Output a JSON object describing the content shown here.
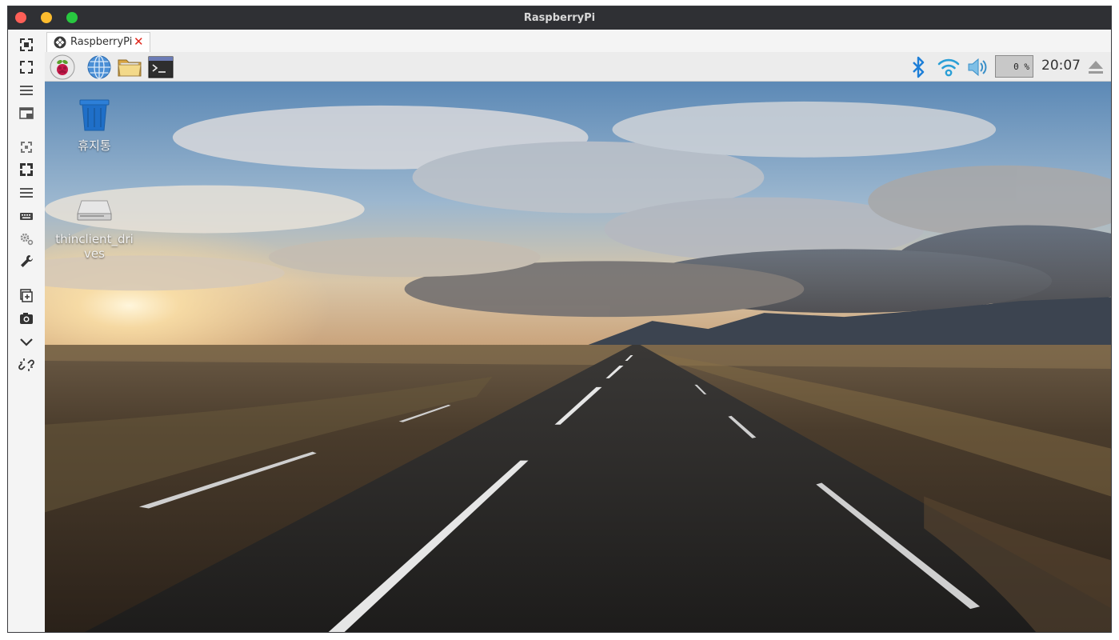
{
  "window": {
    "title": "RaspberryPi",
    "traffic_lights": [
      "close",
      "minimize",
      "zoom"
    ]
  },
  "tab": {
    "label": "RaspberryPi",
    "close_glyph": "✕"
  },
  "sidebar_icons": [
    "fit-window-icon",
    "fullscreen-icon",
    "menu-lines-icon",
    "window-scale-icon",
    "grab-keyboard-icon",
    "fullscreen-expand-icon",
    "list-icon",
    "keyboard-icon",
    "preferences-icon",
    "tools-icon",
    "duplicate-icon",
    "screenshot-icon",
    "chevron-down-icon",
    "disconnect-icon"
  ],
  "panel": {
    "cpu_usage": "0 %",
    "clock": "20:07"
  },
  "desktop": {
    "icons": [
      {
        "label": "휴지통"
      },
      {
        "label": "thinclient_drives"
      }
    ]
  },
  "colors": {
    "titlebar": "#2f3034",
    "close_red": "#fe5f57",
    "minimize_yellow": "#febc2e",
    "zoom_green": "#28c840",
    "bluetooth_blue": "#1e7fd8",
    "wifi_blue": "#2a9fd6",
    "tab_close_red": "#e0261b"
  }
}
